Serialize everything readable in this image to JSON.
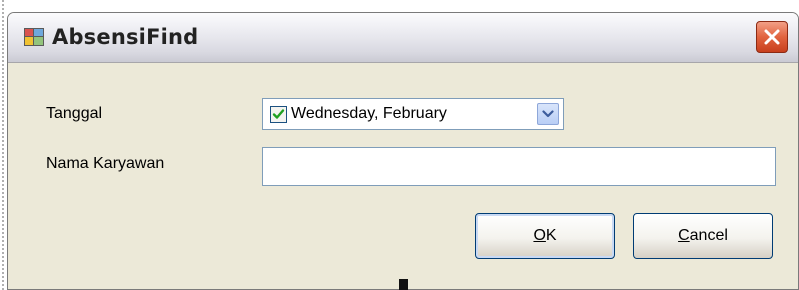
{
  "window": {
    "title": "AbsensiFind",
    "app_icon": "form-app-icon",
    "close_icon": "close-x-icon"
  },
  "form": {
    "tanggal_label": "Tanggal",
    "date_picker": {
      "checked": true,
      "value": "Wednesday,  February",
      "dropdown_icon": "chevron-down-icon"
    },
    "nama_label": "Nama Karyawan",
    "nama_value": ""
  },
  "buttons": {
    "ok_mnemonic": "O",
    "ok_rest": "K",
    "cancel_mnemonic": "C",
    "cancel_rest": "ancel"
  },
  "colors": {
    "window_bg": "#ece9d8",
    "close_button": "#e1633f",
    "input_border": "#7f9db9",
    "button_border": "#003c74",
    "check_mark": "#21a121"
  }
}
